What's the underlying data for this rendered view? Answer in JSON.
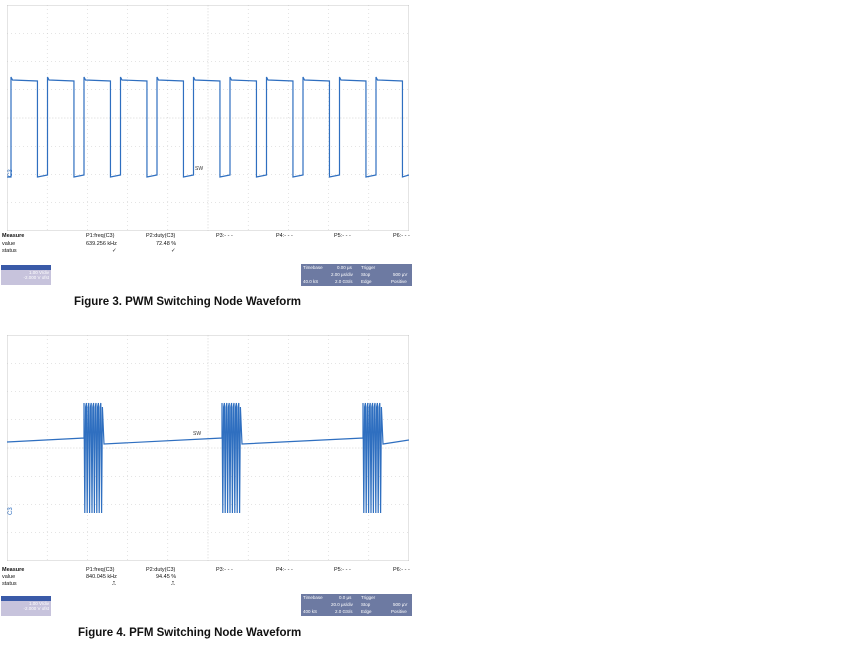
{
  "chart_data": [
    {
      "type": "line",
      "title": "",
      "trace": "PWM",
      "channel_label": "C3",
      "marker_label": "SW",
      "grid": true,
      "measure": {
        "header": "Measure",
        "row_value": "value",
        "row_status": "status",
        "params": [
          {
            "name": "P1:freq(C3)",
            "value": "639.256 kHz",
            "status": "✓"
          },
          {
            "name": "P2:duty(C3)",
            "value": "72.48 %",
            "status": "✓"
          },
          {
            "name": "P3:- - -"
          },
          {
            "name": "P4:- - -"
          },
          {
            "name": "P5:- - -"
          },
          {
            "name": "P6:- - -"
          }
        ]
      },
      "channel_box": {
        "scale": "1.00 V/div",
        "offset": "-2.000 V ofst"
      },
      "timebase": {
        "label": "Timebase",
        "delay": "0.00 µs",
        "div": "2.00 µs/div",
        "samples": "40.0 kS",
        "rate": "2.0 GS/s"
      },
      "trigger": {
        "label": "Trigger",
        "mode": "Stop",
        "level": "500 µV",
        "type": "Edge",
        "slope": "Positive"
      },
      "caption": "Figure 3. PWM Switching Node Waveform"
    },
    {
      "type": "line",
      "title": "",
      "trace": "PFM",
      "channel_label": "C3",
      "marker_label": "SW",
      "grid": true,
      "measure": {
        "header": "Measure",
        "row_value": "value",
        "row_status": "status",
        "params": [
          {
            "name": "P1:freq(C3)",
            "value": "840.045 kHz",
            "status": "⎍"
          },
          {
            "name": "P2:duty(C3)",
            "value": "94.45 %",
            "status": "⎍"
          },
          {
            "name": "P3:- - -"
          },
          {
            "name": "P4:- - -"
          },
          {
            "name": "P5:- - -"
          },
          {
            "name": "P6:- - -"
          }
        ]
      },
      "channel_box": {
        "scale": "1.00 V/div",
        "offset": "-2.000 V ofst"
      },
      "timebase": {
        "label": "Timebase",
        "delay": "0.0 µs",
        "div": "20.0 µs/div",
        "samples": "400 kS",
        "rate": "2.0 GS/s"
      },
      "trigger": {
        "label": "Trigger",
        "mode": "Stop",
        "level": "500 µV",
        "type": "Edge",
        "slope": "Positive"
      },
      "caption": "Figure 4. PFM Switching Node Waveform"
    }
  ]
}
